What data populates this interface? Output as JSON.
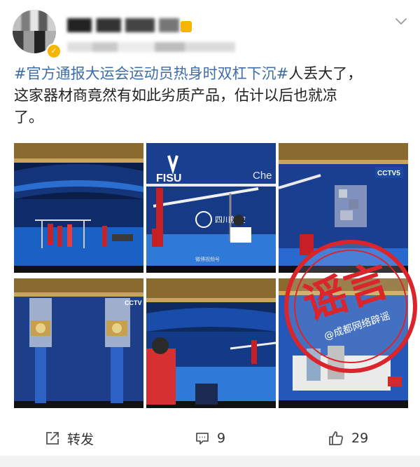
{
  "post": {
    "text_hashtag": "#官方通报大运会运动员热身时双杠下沉#",
    "text_body_1": "人丢大了，",
    "text_body_2": "这家器材商竟然有如此劣质产品，估计以后也就凉",
    "text_body_3": "了。"
  },
  "images": {
    "img2_brand": "FISU",
    "img2_partial": "Che",
    "img2_sponsor": "四川航空",
    "img3_channel": "CCTV5",
    "img4_channel": "CCTV",
    "stamp_main": "谣言",
    "stamp_sub": "@成都网络辟谣"
  },
  "actions": {
    "repost_label": "转发",
    "comment_count": "9",
    "like_count": "29"
  },
  "colors": {
    "hashtag": "#3e6ea9",
    "stamp_red": "#d9252b",
    "verified": "#f7b500"
  }
}
